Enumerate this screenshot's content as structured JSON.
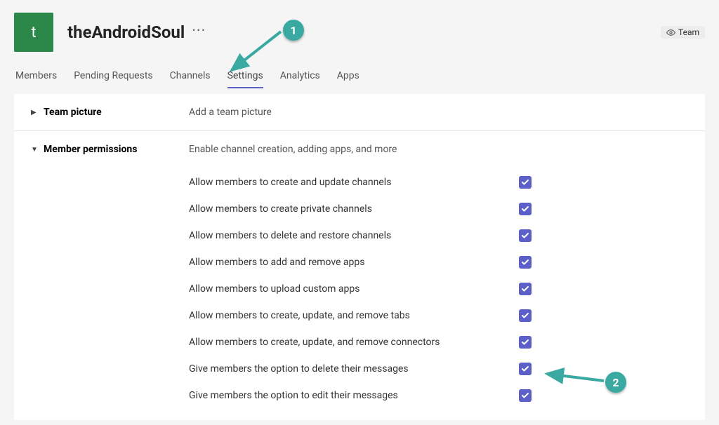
{
  "team": {
    "avatar_letter": "t",
    "name": "theAndroidSoul",
    "visibility_label": "Team"
  },
  "tabs": {
    "members": "Members",
    "pending": "Pending Requests",
    "channels": "Channels",
    "settings": "Settings",
    "analytics": "Analytics",
    "apps": "Apps",
    "active": "settings"
  },
  "sections": {
    "team_picture": {
      "title": "Team picture",
      "subtitle": "Add a team picture"
    },
    "member_permissions": {
      "title": "Member permissions",
      "subtitle": "Enable channel creation, adding apps, and more",
      "items": [
        {
          "label": "Allow members to create and update channels",
          "checked": true
        },
        {
          "label": "Allow members to create private channels",
          "checked": true
        },
        {
          "label": "Allow members to delete and restore channels",
          "checked": true
        },
        {
          "label": "Allow members to add and remove apps",
          "checked": true
        },
        {
          "label": "Allow members to upload custom apps",
          "checked": true
        },
        {
          "label": "Allow members to create, update, and remove tabs",
          "checked": true
        },
        {
          "label": "Allow members to create, update, and remove connectors",
          "checked": true
        },
        {
          "label": "Give members the option to delete their messages",
          "checked": true
        },
        {
          "label": "Give members the option to edit their messages",
          "checked": true
        }
      ]
    }
  },
  "annotations": {
    "one": "1",
    "two": "2",
    "color": "#3aa9a2"
  }
}
